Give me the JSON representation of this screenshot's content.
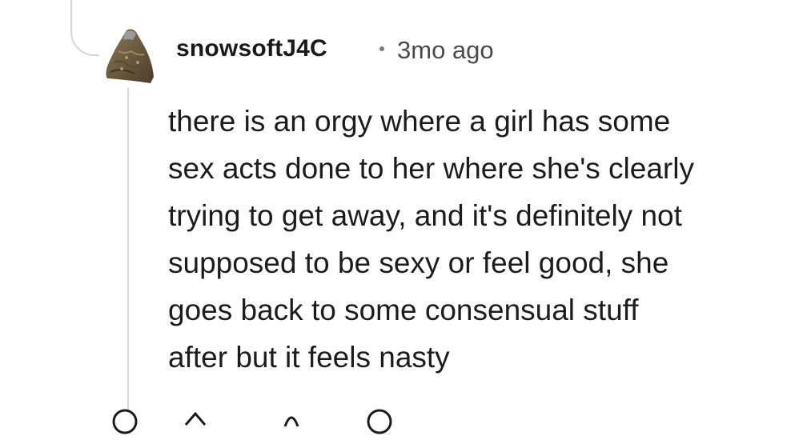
{
  "comment": {
    "author": "snowsoftJ4C",
    "separator": "•",
    "timestamp": "3mo ago",
    "body_lines": [
      "there is an orgy where a girl has some",
      "sex acts done to her where she's clearly",
      "trying to get away, and it's definitely not",
      "supposed to be sexy or feel good, she",
      "goes back to some consensual stuff",
      "after but it feels nasty"
    ]
  },
  "icons": {
    "avatar": "user-avatar",
    "actions": [
      "reply-icon",
      "upvote-icon",
      "award-icon",
      "more-icon"
    ]
  },
  "colors": {
    "text": "#1c1c1c",
    "meta": "#4a4a4a",
    "thread_line": "#d6d6d6"
  }
}
